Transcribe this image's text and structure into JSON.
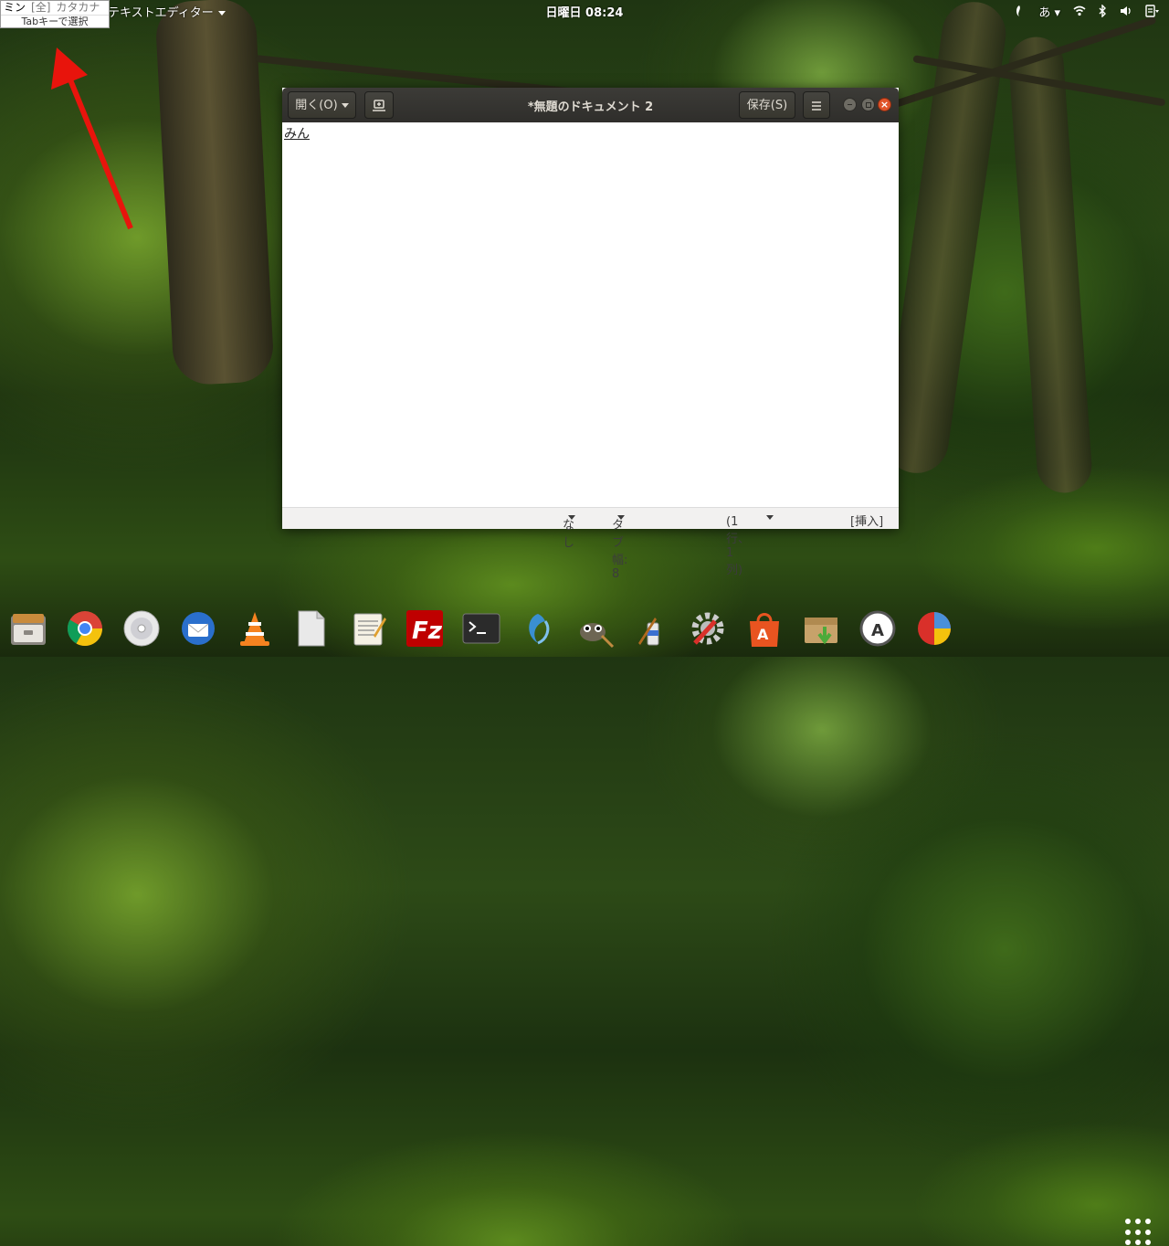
{
  "topbar": {
    "app_menu": "テキストエディター",
    "clock": "日曜日 08:24",
    "input_method": "あ"
  },
  "ime": {
    "candidate_selected": "ミン",
    "candidate_full": "[全]",
    "candidate_katakana": "カタカナ",
    "hint": "Tabキーで選択"
  },
  "window": {
    "title": "*無題のドキュメント 2",
    "open_label": "開く(O)",
    "save_label": "保存(S)",
    "content": "みん",
    "close_glyph": "×"
  },
  "statusbar": {
    "syntax": "なし",
    "tab_width": "タブ幅: 8",
    "position": "(1行、1列)",
    "mode": "[挿入]"
  },
  "dock": {
    "items": [
      "files-icon",
      "chrome-icon",
      "disc-icon",
      "thunderbird-icon",
      "vlc-icon",
      "document-viewer-icon",
      "text-editor-icon",
      "filezilla-icon",
      "terminal-icon",
      "shotwell-icon",
      "gimp-icon",
      "paint-icon",
      "system-tools-icon",
      "software-center-icon",
      "archive-icon",
      "updater-icon",
      "disk-usage-icon",
      "show-apps-icon"
    ]
  },
  "colors": {
    "accent_close": "#e0542a",
    "annotation_arrow": "#e8140c",
    "titlebar": "#3c3b37"
  }
}
